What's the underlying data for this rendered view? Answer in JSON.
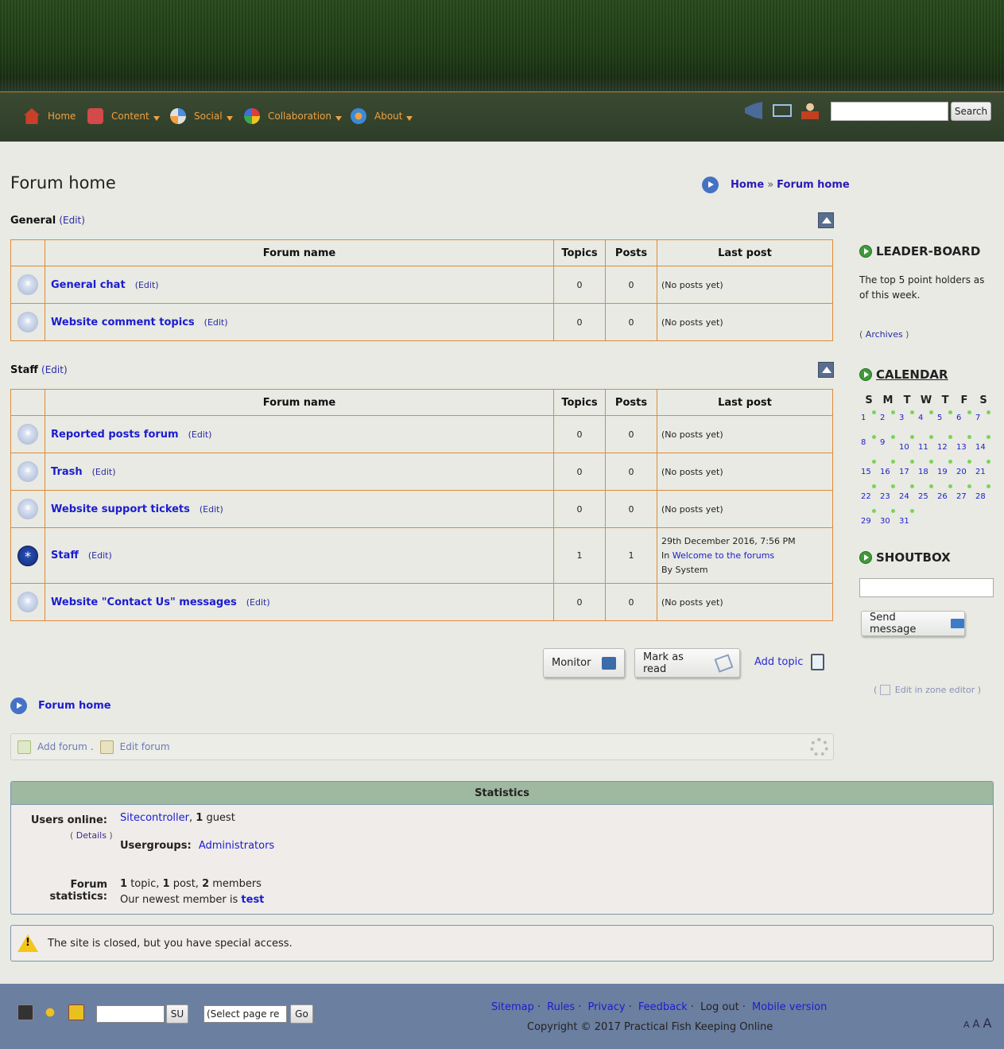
{
  "nav": {
    "items": [
      {
        "label": "Home",
        "icon": "home-icon"
      },
      {
        "label": "Content",
        "icon": "content-icon"
      },
      {
        "label": "Social",
        "icon": "social-icon"
      },
      {
        "label": "Collaboration",
        "icon": "collaboration-icon"
      },
      {
        "label": "About",
        "icon": "about-icon"
      }
    ],
    "search_button": "Search",
    "accent_color": "#f0a040"
  },
  "page": {
    "title": "Forum home",
    "breadcrumb": {
      "home": "Home",
      "sep": "»",
      "current": "Forum home"
    }
  },
  "columns": {
    "icon": "",
    "name": "Forum name",
    "topics": "Topics",
    "posts": "Posts",
    "last": "Last post"
  },
  "sections": [
    {
      "title": "General",
      "edit": "(Edit)",
      "forums": [
        {
          "name": "General chat",
          "edit": "(Edit)",
          "topics": "0",
          "posts": "0",
          "last": "(No posts yet)"
        },
        {
          "name": "Website comment topics",
          "edit": "(Edit)",
          "topics": "0",
          "posts": "0",
          "last": "(No posts yet)"
        }
      ]
    },
    {
      "title": "Staff",
      "edit": "(Edit)",
      "forums": [
        {
          "name": "Reported posts forum",
          "edit": "(Edit)",
          "topics": "0",
          "posts": "0",
          "last": "(No posts yet)"
        },
        {
          "name": "Trash",
          "edit": "(Edit)",
          "topics": "0",
          "posts": "0",
          "last": "(No posts yet)"
        },
        {
          "name": "Website support tickets",
          "edit": "(Edit)",
          "topics": "0",
          "posts": "0",
          "last": "(No posts yet)"
        },
        {
          "name": "Staff",
          "edit": "(Edit)",
          "topics": "1",
          "posts": "1",
          "last_date": "29th December 2016, 7:56 PM",
          "last_in": "In",
          "last_topic": "Welcome to the forums",
          "last_by": "By System"
        },
        {
          "name": "Website \"Contact Us\" messages",
          "edit": "(Edit)",
          "topics": "0",
          "posts": "0",
          "last": "(No posts yet)"
        }
      ]
    }
  ],
  "actions": {
    "monitor": "Monitor",
    "mark_read": "Mark as read",
    "add_topic": "Add topic"
  },
  "bottom_crumb": "Forum home",
  "admin_bar": {
    "add_forum": "Add forum",
    "sep": ".",
    "edit_forum": "Edit forum"
  },
  "stats": {
    "title": "Statistics",
    "users_online_label": "Users online:",
    "details": "Details",
    "online_user": "Sitecontroller",
    "guests_count": "1",
    "guests_label": "guest",
    "usergroups_label": "Usergroups:",
    "usergroup": "Administrators",
    "forum_stats_label": "Forum statistics:",
    "topics_count": "1",
    "topics_label": "topic,",
    "posts_count": "1",
    "posts_label": "post,",
    "members_count": "2",
    "members_label": "members",
    "newest_prefix": "Our newest member is",
    "newest_member": "test"
  },
  "notice": "The site is closed, but you have special access.",
  "sidebar": {
    "leaderboard_title": "LEADER-BOARD",
    "leaderboard_text": "The top 5 point holders as of this week.",
    "archives": "Archives",
    "calendar_title": "CALENDAR",
    "weekdays": [
      "S",
      "M",
      "T",
      "W",
      "T",
      "F",
      "S"
    ],
    "weeks": [
      [
        "1",
        "2",
        "3",
        "4",
        "5",
        "6",
        "7"
      ],
      [
        "8",
        "9",
        "10",
        "11",
        "12",
        "13",
        "14"
      ],
      [
        "15",
        "16",
        "17",
        "18",
        "19",
        "20",
        "21"
      ],
      [
        "22",
        "23",
        "24",
        "25",
        "26",
        "27",
        "28"
      ],
      [
        "29",
        "30",
        "31",
        "",
        "",
        "",
        ""
      ]
    ],
    "shoutbox_title": "SHOUTBOX",
    "send_message": "Send message",
    "zone_editor": "Edit in zone editor"
  },
  "footer": {
    "su_button": "SU",
    "select_placeholder": "(Select page re",
    "go_button": "Go",
    "links": [
      "Sitemap",
      "Rules",
      "Privacy",
      "Feedback"
    ],
    "logout": "Log out",
    "mobile": "Mobile version",
    "copyright": "Copyright © 2017 Practical Fish Keeping Online",
    "font_sizes": [
      "A",
      "A",
      "A"
    ]
  }
}
